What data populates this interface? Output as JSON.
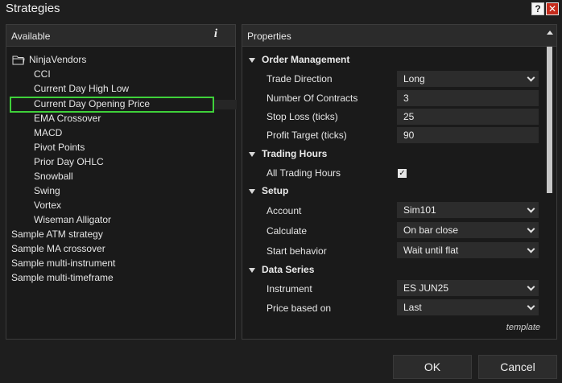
{
  "window": {
    "title": "Strategies",
    "help_label": "?",
    "close_label": "✕"
  },
  "available": {
    "header": "Available",
    "info_label": "i",
    "folder": "NinjaVendors",
    "vendor_items": [
      "CCI",
      "Current Day High Low",
      "Current Day Opening Price",
      "EMA Crossover",
      "MACD",
      "Pivot Points",
      "Prior Day OHLC",
      "Snowball",
      "Swing",
      "Vortex",
      "Wiseman Alligator"
    ],
    "selected_item": "Current Day Opening Price",
    "root_items": [
      "Sample ATM strategy",
      "Sample MA crossover",
      "Sample multi-instrument",
      "Sample multi-timeframe"
    ]
  },
  "properties": {
    "header": "Properties",
    "order_management": {
      "label": "Order Management",
      "trade_direction": {
        "label": "Trade Direction",
        "value": "Long"
      },
      "number_of_contracts": {
        "label": "Number Of Contracts",
        "value": "3"
      },
      "stop_loss": {
        "label": "Stop Loss (ticks)",
        "value": "25"
      },
      "profit_target": {
        "label": "Profit Target (ticks)",
        "value": "90"
      }
    },
    "trading_hours": {
      "label": "Trading Hours",
      "all_trading_hours": {
        "label": "All Trading Hours",
        "checked": true,
        "mark": "✓"
      }
    },
    "setup": {
      "label": "Setup",
      "account": {
        "label": "Account",
        "value": "Sim101"
      },
      "calculate": {
        "label": "Calculate",
        "value": "On bar close"
      },
      "start_behavior": {
        "label": "Start behavior",
        "value": "Wait until flat"
      }
    },
    "data_series": {
      "label": "Data Series",
      "instrument": {
        "label": "Instrument",
        "value": "ES JUN25"
      },
      "price_based_on": {
        "label": "Price based on",
        "value": "Last"
      }
    },
    "template_link": "template"
  },
  "buttons": {
    "ok": "OK",
    "cancel": "Cancel"
  },
  "colors": {
    "selection_outline": "#3fd13a",
    "close_button": "#c42b1c",
    "background": "#1e1e1e"
  }
}
